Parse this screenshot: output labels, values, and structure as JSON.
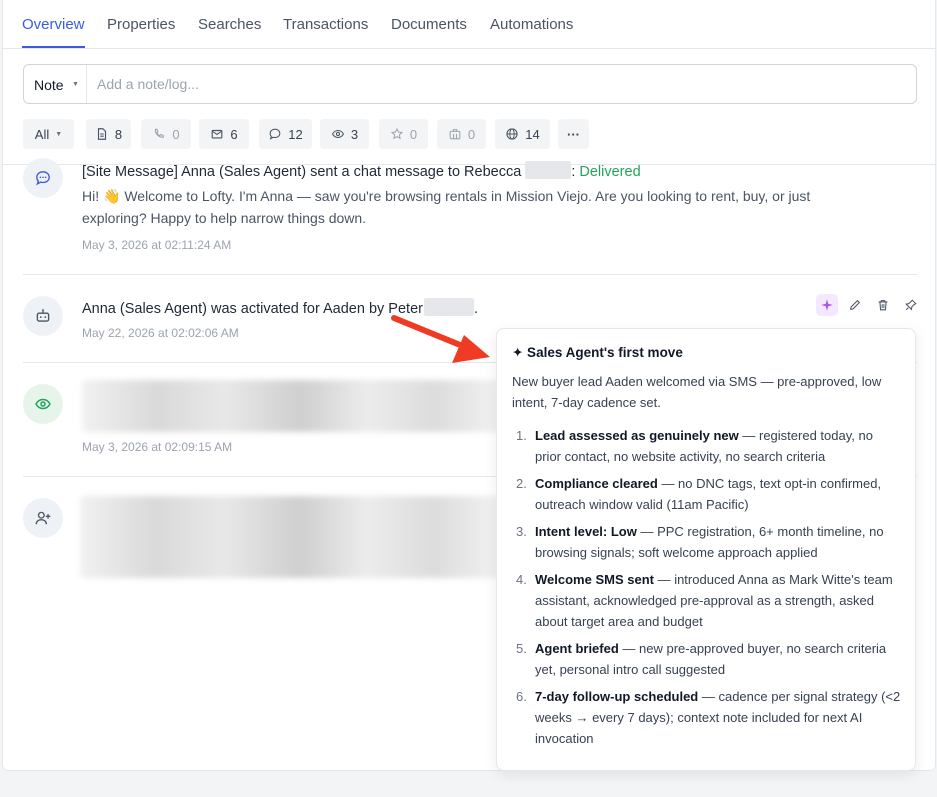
{
  "tabs": [
    "Overview",
    "Properties",
    "Searches",
    "Transactions",
    "Documents",
    "Automations"
  ],
  "note": {
    "type": "Note",
    "placeholder": "Add a note/log..."
  },
  "filters": {
    "all": "All",
    "counts": {
      "notes": "8",
      "calls": "0",
      "emails": "6",
      "texts": "12",
      "views": "3",
      "favorites": "0",
      "properties": "0",
      "web": "14"
    },
    "more": "···"
  },
  "entries": [
    {
      "title": "[Site Message] Anna (Sales Agent) sent a chat message to Rebecca",
      "title_suffix": ":",
      "status": "Delivered",
      "body": "Hi! 👋 Welcome to Lofty. I'm Anna — saw you're browsing rentals in Mission Viejo. Are you looking to rent, buy, or just exploring? Happy to help narrow things down.",
      "time": "May 3, 2026 at 02:11:24 AM"
    },
    {
      "title": "Anna (Sales Agent) was activated for Aaden by Peter",
      "title_suffix": ".",
      "time": "May 22, 2026 at 02:02:06 AM"
    },
    {
      "time": "May 3, 2026 at 02:09:15 AM"
    }
  ],
  "popover": {
    "title": "✦ Sales Agent's first move",
    "summary": "New buyer lead Aaden welcomed via SMS — pre-approved, low intent, 7-day cadence set.",
    "steps": [
      {
        "n": "1.",
        "bold": "Lead assessed as genuinely new",
        "rest": " — registered today, no prior contact, no website activity, no search criteria"
      },
      {
        "n": "2.",
        "bold": "Compliance cleared",
        "rest": " — no DNC tags, text opt-in confirmed, outreach window valid (11am Pacific)"
      },
      {
        "n": "3.",
        "bold": "Intent level: Low",
        "rest": " — PPC registration, 6+ month timeline, no browsing signals; soft welcome approach applied"
      },
      {
        "n": "4.",
        "bold": "Welcome SMS sent",
        "rest": " — introduced Anna as Mark Witte's team assistant, acknowledged pre-approval as a strength, asked about target area and budget"
      },
      {
        "n": "5.",
        "bold": "Agent briefed",
        "rest": " — new pre-approved buyer, no search criteria yet, personal intro call suggested"
      },
      {
        "n": "6.",
        "bold": "7-day follow-up scheduled",
        "rest": " — cadence per signal strategy (<2 weeks → every 7 days); context note included for next AI invocation"
      }
    ]
  },
  "colors": {
    "accent": "#3b5bdb",
    "delivered": "#22a35a",
    "ai": "#a855f7",
    "arrow": "#ef3b24"
  }
}
